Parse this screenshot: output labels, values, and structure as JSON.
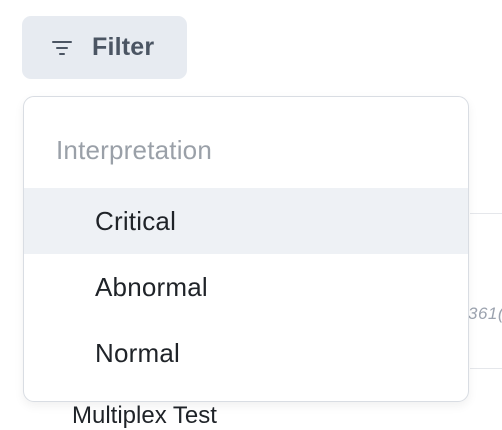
{
  "filter_button": {
    "label": "Filter",
    "icon": "filter-lines-icon"
  },
  "dropdown": {
    "section_heading": "Interpretation",
    "options": [
      {
        "label": "Critical",
        "highlighted": true
      },
      {
        "label": "Abnormal",
        "highlighted": false
      },
      {
        "label": "Normal",
        "highlighted": false
      }
    ]
  },
  "background": {
    "partial_id": "361(",
    "partial_row_text": "Multiplex Test"
  },
  "colors": {
    "button_bg": "#e7ebf1",
    "button_text": "#4b5563",
    "highlight_bg": "#eef1f5",
    "heading_text": "#9aa0a8",
    "border": "#d9dde3"
  }
}
